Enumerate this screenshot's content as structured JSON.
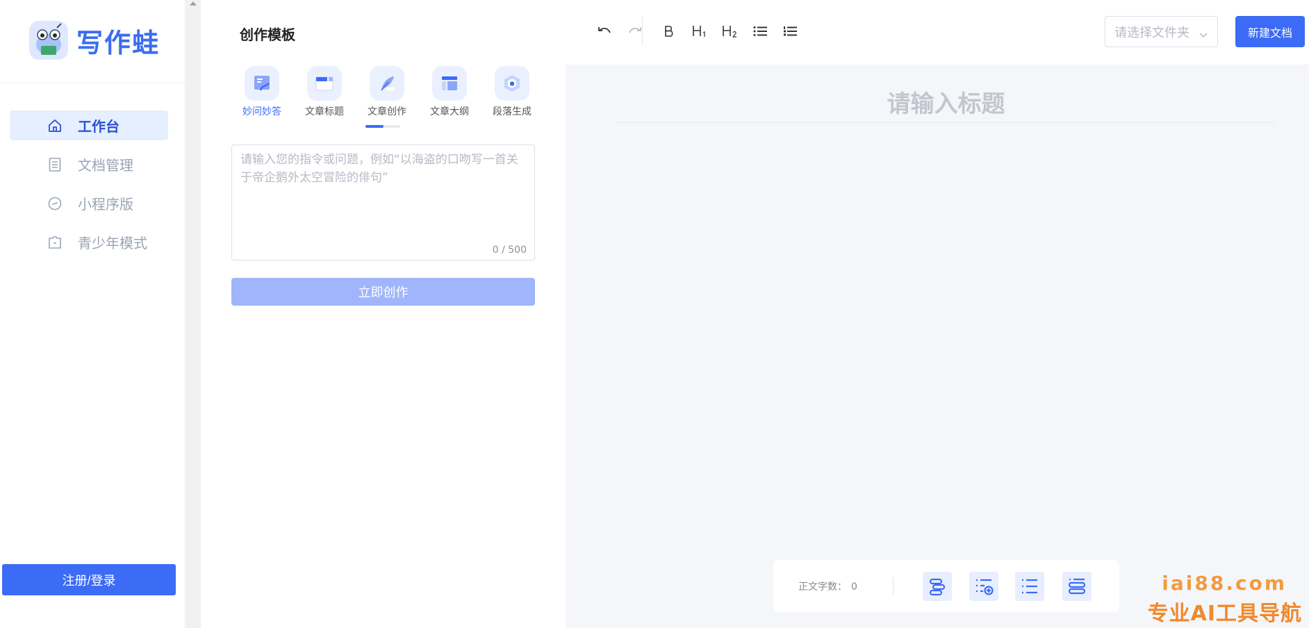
{
  "app": {
    "logo_text": "写作蛙"
  },
  "sidebar": {
    "items": [
      {
        "label": "工作台",
        "icon": "home-icon",
        "active": true
      },
      {
        "label": "文档管理",
        "icon": "document-list-icon",
        "active": false
      },
      {
        "label": "小程序版",
        "icon": "mini-program-icon",
        "active": false
      },
      {
        "label": "青少年模式",
        "icon": "youth-mode-icon",
        "active": false
      }
    ],
    "login_label": "注册/登录"
  },
  "panel": {
    "title": "创作模板",
    "tabs": [
      {
        "label": "妙问妙答",
        "icon": "qa-icon",
        "active": true
      },
      {
        "label": "文章标题",
        "icon": "article-title-icon",
        "active": false
      },
      {
        "label": "文章创作",
        "icon": "feather-pen-icon",
        "active": false
      },
      {
        "label": "文章大纲",
        "icon": "outline-icon",
        "active": false
      },
      {
        "label": "段落生成",
        "icon": "paragraph-hexagon-icon",
        "active": false
      }
    ],
    "prompt": {
      "value": "",
      "placeholder": "请输入您的指令或问题，例如“以海盗的口吻写一首关于帝企鹅外太空冒险的俳句”",
      "counter": "0 / 500"
    },
    "create_label": "立即创作"
  },
  "toolbar": {
    "tools": [
      "undo-icon",
      "redo-icon",
      "bold-icon",
      "heading1-icon",
      "heading2-icon",
      "bullet-list-icon",
      "ordered-list-icon"
    ],
    "folder_placeholder": "请选择文件夹",
    "new_doc_label": "新建文档"
  },
  "editor": {
    "title_value": "",
    "title_placeholder": "请输入标题"
  },
  "statusbar": {
    "word_count_label": "正文字数：",
    "word_count_value": "0",
    "actions": [
      "align-paragraph-icon",
      "add-list-icon",
      "list-icon",
      "stacked-list-icon"
    ]
  },
  "watermark": {
    "domain": "iai88.com",
    "slogan": "专业AI工具导航"
  },
  "colors": {
    "accent": "#3c6bf6",
    "accent_light": "#e6efff",
    "disabled_button": "#a0b5fb",
    "watermark": "#f39b3d"
  }
}
